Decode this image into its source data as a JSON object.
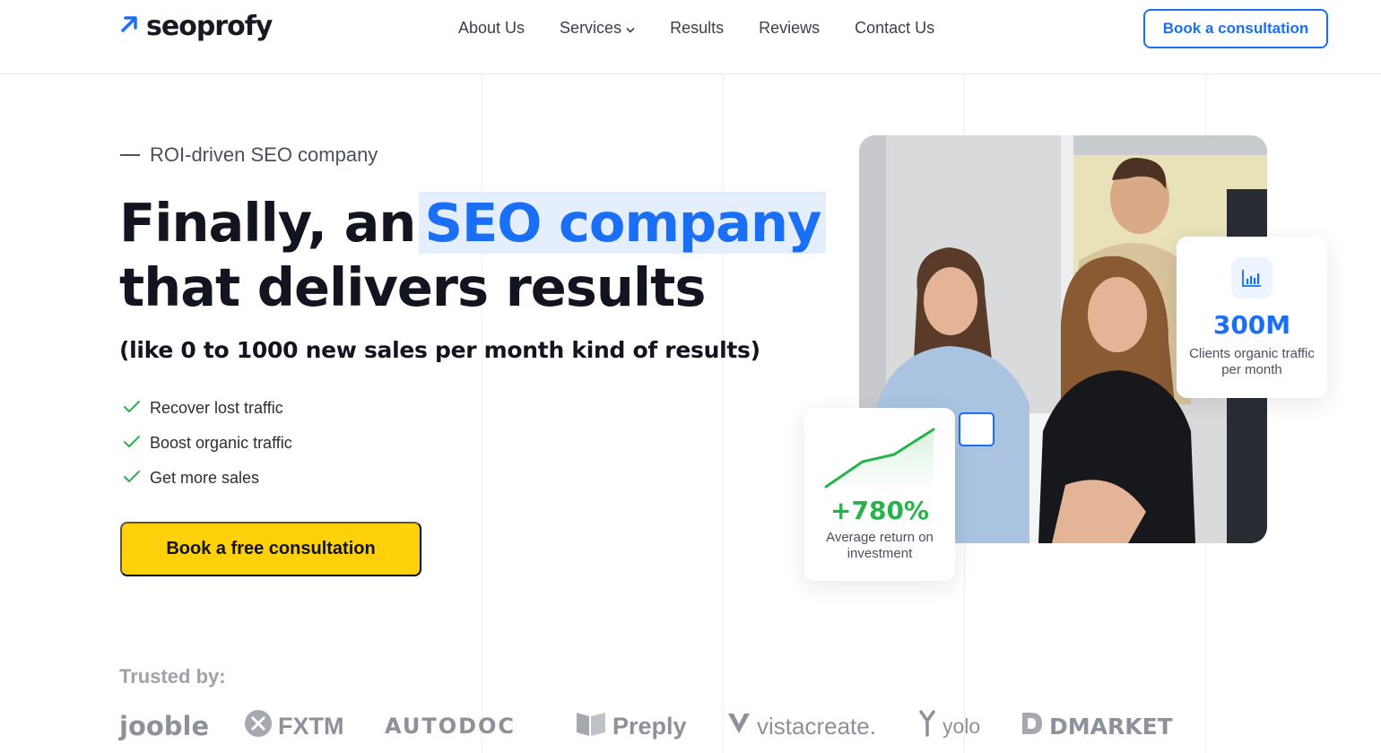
{
  "header": {
    "logo_text": "seoprofy",
    "nav": [
      {
        "label": "About Us"
      },
      {
        "label": "Services",
        "has_dropdown": true
      },
      {
        "label": "Results"
      },
      {
        "label": "Reviews"
      },
      {
        "label": "Contact Us"
      }
    ],
    "cta_label": "Book a consultation"
  },
  "hero": {
    "eyebrow": "ROI-driven SEO company",
    "headline_part1": "Finally, an",
    "headline_accent": "SEO company",
    "headline_line2": "that delivers results",
    "subheadline": "(like 0 to 1000 new sales per month kind of results)",
    "benefits": [
      "Recover lost traffic",
      "Boost organic traffic",
      "Get more sales"
    ],
    "cta_label": "Book a free consultation"
  },
  "stats": {
    "roi": {
      "value": "+780%",
      "label": "Average return on investment"
    },
    "traffic": {
      "value": "300M",
      "label": "Clients organic traffic per month"
    }
  },
  "trusted": {
    "title": "Trusted by:",
    "logos": [
      "jooble",
      "FXTM",
      "AUTODOC",
      "Preply",
      "vistacreate.",
      "yolo",
      "DMARKET"
    ]
  },
  "colors": {
    "accent_blue": "#1a6ff5",
    "cta_yellow": "#ffd10a",
    "success_green": "#27b34a",
    "text_dark": "#12151f"
  },
  "icons": {
    "logo": "arrow-up-right-icon",
    "services_dropdown": "chevron-down-icon",
    "benefit": "check-icon",
    "traffic_stat": "bar-chart-icon",
    "roi_stat": "trend-line-icon"
  }
}
